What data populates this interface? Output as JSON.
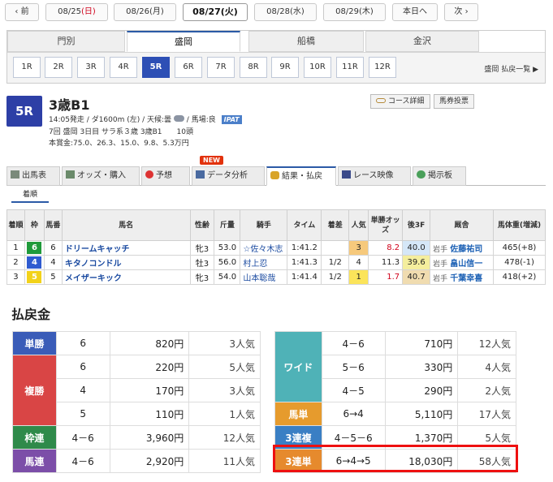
{
  "date_nav": {
    "prev": "前",
    "days": [
      {
        "label": "08/25",
        "weekday": "(日)",
        "weekday_color": "#d0021b"
      },
      {
        "label": "08/26",
        "weekday": "(月)",
        "weekday_color": "#333333"
      },
      {
        "label": "08/27",
        "weekday": "(火)",
        "weekday_color": "#111111",
        "selected": true
      },
      {
        "label": "08/28",
        "weekday": "(水)",
        "weekday_color": "#333333"
      },
      {
        "label": "08/29",
        "weekday": "(木)",
        "weekday_color": "#333333"
      }
    ],
    "today": "本日へ",
    "next": "次"
  },
  "venues": [
    "門別",
    "盛岡",
    "船橋",
    "金沢"
  ],
  "venue_selected": "盛岡",
  "races": [
    "1R",
    "2R",
    "3R",
    "4R",
    "5R",
    "6R",
    "7R",
    "8R",
    "9R",
    "10R",
    "11R",
    "12R"
  ],
  "race_selected": "5R",
  "payout_list_link": "盛岡 払戻一覧",
  "race": {
    "badge": "5R",
    "title": "3歳B1",
    "info1": "14:05発走 / ダ1600m (左) / 天候:曇",
    "info1b": "/ 馬場:良",
    "ipat": "IPAT",
    "info2": "7回 盛岡 3日目 サラ系３歳 3歳B1　　10頭",
    "info3": "本賞金:75.0、26.3、15.0、9.8、5.3万円",
    "course_button": "コース詳細",
    "vote_button": "馬券投票"
  },
  "tabs": [
    "出馬表",
    "オッズ・購入",
    "予想",
    "データ分析",
    "結果・払戻",
    "レース映像",
    "掲示板"
  ],
  "tab_active": "結果・払戻",
  "new_badge": "NEW",
  "subtab": "着順",
  "result_headers": [
    "着順",
    "枠",
    "馬番",
    "馬名",
    "性齢",
    "斤量",
    "騎手",
    "タイム",
    "着差",
    "人気",
    "単勝オッズ",
    "後3F",
    "厩舎",
    "馬体重(増減)"
  ],
  "results": [
    {
      "rank": "1",
      "waku": "6",
      "waku_bg": "#1f9a3a",
      "waku_fg": "#ffffff",
      "umaban": "6",
      "name": "ドリームキャッチ",
      "sexage": "牝3",
      "kinryo": "53.0",
      "jockey": "☆佐々木志",
      "time": "1:41.2",
      "margin": "",
      "ninki": "3",
      "odds": "8.2",
      "odds_color": "#d0021b",
      "last3f": "40.0",
      "stable_area": "岩手",
      "trainer": "佐藤祐司",
      "weight": "465(+8)"
    },
    {
      "rank": "2",
      "waku": "4",
      "waku_bg": "#2f5bd0",
      "waku_fg": "#ffffff",
      "umaban": "4",
      "name": "キタノコンドル",
      "sexage": "牡3",
      "kinryo": "56.0",
      "jockey": "村上忍",
      "time": "1:41.3",
      "margin": "1/2",
      "ninki": "4",
      "odds": "11.3",
      "odds_color": "#222222",
      "last3f": "39.6",
      "stable_area": "岩手",
      "trainer": "畠山信一",
      "weight": "478(-1)"
    },
    {
      "rank": "3",
      "waku": "5",
      "waku_bg": "#f2d21b",
      "waku_fg": "#ffffff",
      "umaban": "5",
      "name": "メイザーキック",
      "sexage": "牝3",
      "kinryo": "54.0",
      "jockey": "山本聡哉",
      "time": "1:41.4",
      "margin": "1/2",
      "ninki": "1",
      "odds": "1.7",
      "odds_color": "#d0021b",
      "last3f": "40.7",
      "stable_area": "岩手",
      "trainer": "千葉幸喜",
      "weight": "418(+2)"
    }
  ],
  "payout_heading": "払戻金",
  "payout_left": {
    "tansho": {
      "label": "単勝",
      "color": "#3a5cb8",
      "rows": [
        {
          "combo": "6",
          "yen": "820円",
          "pop": "3人気"
        }
      ]
    },
    "fukusho": {
      "label": "複勝",
      "color": "#d94545",
      "rows": [
        {
          "combo": "6",
          "yen": "220円",
          "pop": "5人気"
        },
        {
          "combo": "4",
          "yen": "170円",
          "pop": "3人気"
        },
        {
          "combo": "5",
          "yen": "110円",
          "pop": "1人気"
        }
      ]
    },
    "wakuren": {
      "label": "枠連",
      "color": "#2f8a4a",
      "rows": [
        {
          "combo": "4－6",
          "yen": "3,960円",
          "pop": "12人気"
        }
      ]
    },
    "umaren": {
      "label": "馬連",
      "color": "#7c4ea8",
      "rows": [
        {
          "combo": "4－6",
          "yen": "2,920円",
          "pop": "11人気"
        }
      ]
    }
  },
  "payout_right": {
    "wide": {
      "label": "ワイド",
      "color": "#4fb2b7",
      "rows": [
        {
          "combo": "4－6",
          "yen": "710円",
          "pop": "12人気"
        },
        {
          "combo": "5－6",
          "yen": "330円",
          "pop": "4人気"
        },
        {
          "combo": "4－5",
          "yen": "290円",
          "pop": "2人気"
        }
      ]
    },
    "umatan": {
      "label": "馬単",
      "color": "#e69b2d",
      "rows": [
        {
          "combo": "6→4",
          "yen": "5,110円",
          "pop": "17人気"
        }
      ]
    },
    "sanrenpuku": {
      "label": "3連複",
      "color": "#3a7fc4",
      "rows": [
        {
          "combo": "4－5－6",
          "yen": "1,370円",
          "pop": "5人気"
        }
      ]
    },
    "sanrentan": {
      "label": "3連単",
      "color": "#e68a2d",
      "rows": [
        {
          "combo": "6→4→5",
          "yen": "18,030円",
          "pop": "58人気"
        }
      ]
    }
  }
}
